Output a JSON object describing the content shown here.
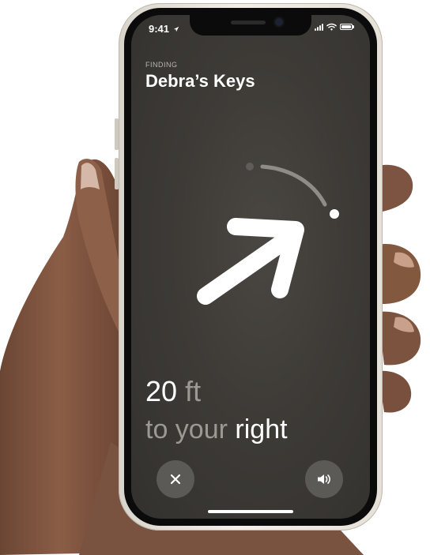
{
  "status_bar": {
    "time": "9:41",
    "location_arrow_icon": "location-arrow-icon",
    "signal_icon": "cellular-signal-icon",
    "wifi_icon": "wifi-icon",
    "battery_icon": "battery-icon"
  },
  "header": {
    "label": "FINDING",
    "title": "Debra’s Keys"
  },
  "guidance": {
    "direction_arrow_icon": "direction-arrow-icon",
    "distance_value": "20",
    "distance_unit": "ft",
    "direction_prefix": "to your",
    "direction_word": "right"
  },
  "controls": {
    "close_icon": "close-icon",
    "sound_icon": "speaker-icon"
  },
  "colors": {
    "screen_bg": "#3e3b37",
    "primary_text": "#ffffff",
    "secondary_text": "#9c9993",
    "button_bg": "#5c5a57"
  }
}
